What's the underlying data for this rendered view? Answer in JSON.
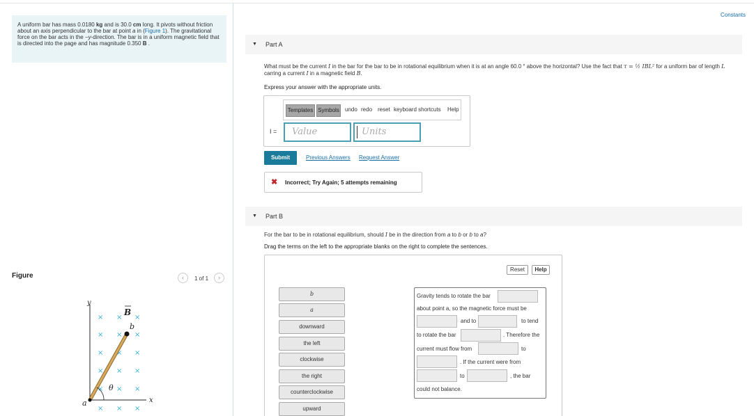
{
  "problem": {
    "part1": "A uniform bar has mass 0.0180 ",
    "mass_unit": "kg",
    "part2": " and is 30.0 ",
    "length_unit": "cm",
    "part3": " long. It pivots without friction about an axis perpendicular to the bar at point ",
    "point_a": "a",
    "part4": " in (",
    "figure_link": "Figure 1",
    "part5": "). The gravitational force on the bar acts in the ",
    "direction": "−y",
    "part6": "-direction. The bar is in a uniform magnetic field that is directed into the page and has magnitude 0.350 ",
    "field_unit": "B",
    "part7": " ."
  },
  "constants_link": "Constants",
  "partA": {
    "title": "Part A",
    "question_1": "What must be the current ",
    "I": "I",
    "question_2": " in the bar for the bar to be in rotational equilibrium when it is at an angle 60.0 ° above the horizontal? Use the fact that ",
    "tau_formula": "τ = ½ IBL²",
    "question_3": " for a uniform bar of length ",
    "L": "L",
    "question_4": " carring a current ",
    "question_5": " in a magnetic field ",
    "B": "B",
    "question_6": ".",
    "instruction": "Express your answer with the appropriate units.",
    "toolbar": {
      "templates": "Templates",
      "symbols": "Symbols",
      "undo": "undo",
      "redo": "redo",
      "reset": "reset",
      "shortcuts": "keyboard shortcuts",
      "help": "Help"
    },
    "input_label": "I =",
    "value_placeholder": "Value",
    "units_placeholder": "Units",
    "submit": "Submit",
    "previous_answers": "Previous Answers",
    "request_answer": "Request Answer",
    "feedback": "Incorrect; Try Again; 5 attempts remaining"
  },
  "partB": {
    "title": "Part B",
    "question_1": "For the bar to be in rotational equilibrium, should ",
    "I": "I",
    "question_2": " be in the direction from ",
    "a": "a",
    "question_3": " to ",
    "b": "b",
    "question_4": " or ",
    "question_5": " to ",
    "question_6": "?",
    "instruction": "Drag the terms on the left to the appropriate blanks on the right to complete the sentences.",
    "reset": "Reset",
    "help": "Help",
    "chips": [
      "b",
      "a",
      "downward",
      "the left",
      "clockwise",
      "the right",
      "counterclockwise",
      "upward"
    ],
    "sentence": {
      "s1": "Gravity tends to rotate the bar",
      "s2": "about point a, so the magnetic force must be",
      "s3": "and to",
      "s4": "to tend",
      "s5": "to rotate the bar",
      "s6": ". Therefore the",
      "s7": "current must flow from",
      "s8": "to",
      "s9": ". If the current were from",
      "s10": "to",
      "s11": ", the bar",
      "s12": "could not balance."
    }
  },
  "figure": {
    "title": "Figure",
    "pager": "1 of 1",
    "labels": {
      "y": "y",
      "x": "x",
      "B": "B",
      "a": "a",
      "b": "b",
      "theta": "θ"
    }
  },
  "colors": {
    "accent": "#1a7c9a",
    "link": "#1a6ea8",
    "error": "#c0282d",
    "problem_bg": "#e9f4f7",
    "bar": "#d8a95c",
    "field_x": "#3ab0d8"
  }
}
